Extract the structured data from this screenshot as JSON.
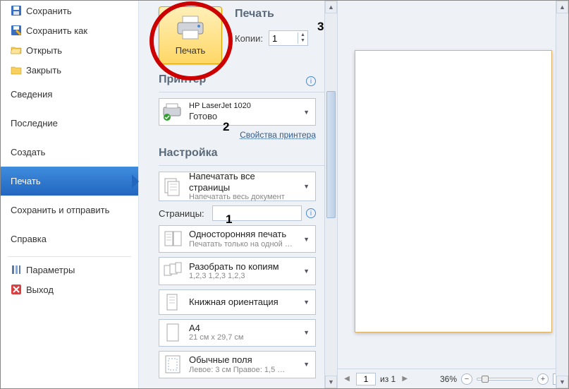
{
  "sidebar": {
    "save": "Сохранить",
    "save_as": "Сохранить как",
    "open": "Открыть",
    "close": "Закрыть",
    "info": "Сведения",
    "recent": "Последние",
    "new": "Создать",
    "print": "Печать",
    "save_send": "Сохранить и отправить",
    "help": "Справка",
    "options": "Параметры",
    "exit": "Выход"
  },
  "print": {
    "header": "Печать",
    "button_label": "Печать",
    "copies_label": "Копии:",
    "copies_value": "1",
    "printer_header": "Принтер",
    "printer_name": "HP LaserJet 1020",
    "printer_status": "Готово",
    "printer_props": "Свойства принтера",
    "settings_header": "Настройка",
    "print_all_title": "Напечатать все страницы",
    "print_all_sub": "Напечатать весь документ",
    "pages_label": "Страницы:",
    "pages_value": "",
    "oneside_title": "Односторонняя печать",
    "oneside_sub": "Печатать только на одной …",
    "collate_title": "Разобрать по копиям",
    "collate_sub": "1,2,3   1,2,3   1,2,3",
    "orient_title": "Книжная ориентация",
    "paper_title": "A4",
    "paper_sub": "21 см x 29,7 см",
    "margins_title": "Обычные поля",
    "margins_sub": "Левое: 3 см   Правое: 1,5 …"
  },
  "preview": {
    "page_current": "1",
    "page_of": "из 1",
    "zoom": "36%"
  },
  "annotations": {
    "one": "1",
    "two": "2",
    "three": "3"
  }
}
